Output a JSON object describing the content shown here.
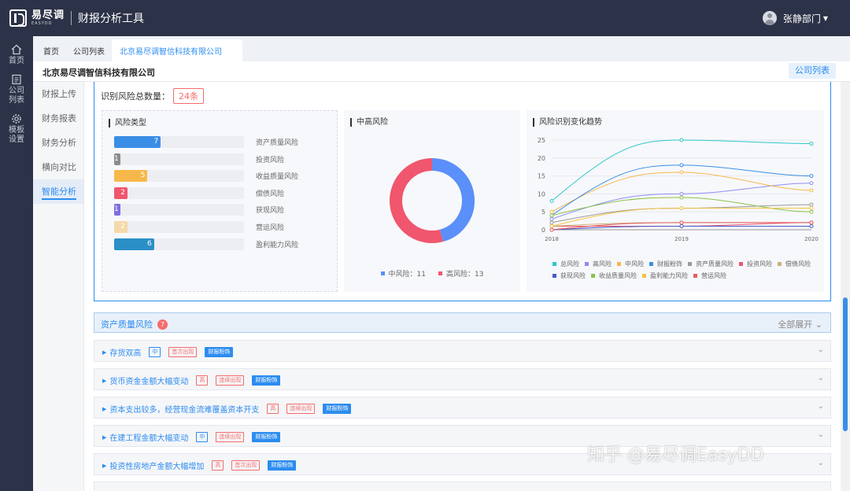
{
  "app": {
    "logo_cn": "易尽调",
    "logo_en": "EASYDD",
    "title": "财报分析工具",
    "user": "张静部门"
  },
  "left_nav": [
    {
      "label": "首页",
      "icon": "home-icon"
    },
    {
      "label": "公司\n列表",
      "icon": "list-icon"
    },
    {
      "label": "模板\n设置",
      "icon": "gear-icon"
    }
  ],
  "tabs": [
    "首页",
    "公司列表",
    "北京易尽调智信科技有限公司"
  ],
  "page": {
    "title": "北京易尽调智信科技有限公司",
    "company_list_button": "公司列表"
  },
  "sub_nav": [
    "财报上传",
    "财务报表",
    "财务分析",
    "横向对比",
    "智能分析"
  ],
  "risk": {
    "total_label": "识别风险总数量：",
    "total_value": "24条"
  },
  "risk_types": {
    "title": "风险类型",
    "items": [
      {
        "label": "资产质量风险",
        "value": 7,
        "color": "#3a8ee6"
      },
      {
        "label": "投资风险",
        "value": 1,
        "color": "#8c8c8c"
      },
      {
        "label": "收益质量风险",
        "value": 5,
        "color": "#f7b84b"
      },
      {
        "label": "偿债风险",
        "value": 2,
        "color": "#f0566e"
      },
      {
        "label": "获现风险",
        "value": 1,
        "color": "#7b6fe0"
      },
      {
        "label": "营运风险",
        "value": 2,
        "color": "#f5d9a8"
      },
      {
        "label": "盈利能力风险",
        "value": 6,
        "color": "#2b8fc7"
      }
    ]
  },
  "donut": {
    "title": "中高风险",
    "segments": [
      {
        "label": "中风险",
        "value": 11,
        "color": "#5b8ff9"
      },
      {
        "label": "高风险",
        "value": 13,
        "color": "#f0566e"
      }
    ],
    "legend_mid": "中风险：11",
    "legend_high": "高风险：13"
  },
  "chart_data": {
    "type": "line",
    "title": "风险识别变化趋势",
    "x": [
      "2018",
      "2019",
      "2020"
    ],
    "ylim": [
      0,
      25
    ],
    "yticks": [
      "0",
      "5",
      "10",
      "15",
      "20",
      "25"
    ],
    "series": [
      {
        "name": "总风险",
        "color": "#2ec7c9",
        "values": [
          8,
          25,
          24
        ]
      },
      {
        "name": "高风险",
        "color": "#8d8ef0",
        "values": [
          3,
          10,
          13
        ]
      },
      {
        "name": "中风险",
        "color": "#f7b84b",
        "values": [
          5,
          16,
          11
        ]
      },
      {
        "name": "财报粉饰",
        "color": "#3a8ee6",
        "values": [
          4,
          18,
          15
        ]
      },
      {
        "name": "资产质量风险",
        "color": "#9a9a9a",
        "values": [
          2,
          6,
          7
        ]
      },
      {
        "name": "投资风险",
        "color": "#f0566e",
        "values": [
          1,
          1,
          2
        ]
      },
      {
        "name": "偿债风险",
        "color": "#c9b27c",
        "values": [
          1,
          2,
          2
        ]
      },
      {
        "name": "获现风险",
        "color": "#4b5cc4",
        "values": [
          0,
          1,
          1
        ]
      },
      {
        "name": "收益质量风险",
        "color": "#8bc34a",
        "values": [
          4,
          9,
          5
        ]
      },
      {
        "name": "盈利能力风险",
        "color": "#f5c242",
        "values": [
          1,
          6,
          6
        ]
      },
      {
        "name": "营运风险",
        "color": "#e85d5d",
        "values": [
          0,
          2,
          2
        ]
      }
    ]
  },
  "section": {
    "title": "资产质量风险",
    "badge": "7",
    "expand_all": "全部展开"
  },
  "risk_items": [
    {
      "title": "存货双高",
      "level": "中",
      "occurrence": "首次出现",
      "category": "财报粉饰"
    },
    {
      "title": "货币资金金额大幅变动",
      "level": "高",
      "occurrence": "连续出现",
      "category": "财报粉饰"
    },
    {
      "title": "资本支出较多，经营现金流难覆盖资本开支",
      "level": "高",
      "occurrence": "连续出现",
      "category": "财报粉饰"
    },
    {
      "title": "在建工程金额大幅变动",
      "level": "中",
      "occurrence": "连续出现",
      "category": "财报粉饰"
    },
    {
      "title": "投资性房地产金额大幅增加",
      "level": "高",
      "occurrence": "首次出现",
      "category": "财报粉饰"
    }
  ],
  "watermark": "知乎 @易尽调EasyDD"
}
